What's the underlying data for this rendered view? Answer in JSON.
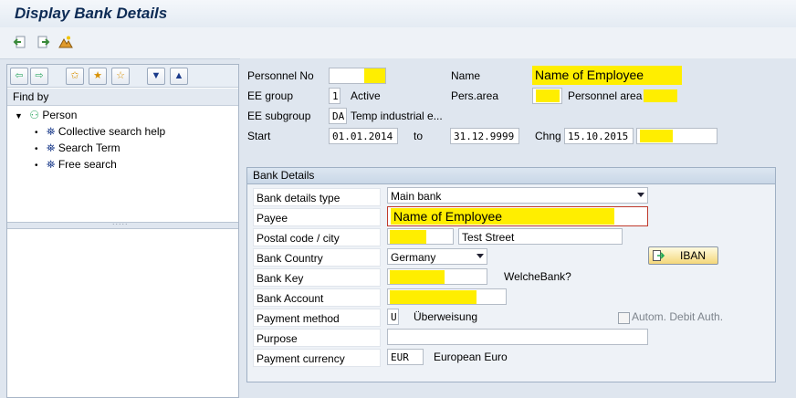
{
  "window": {
    "title": "Display Bank Details"
  },
  "toolbar": {
    "icons": [
      "previous-record-icon",
      "next-record-icon",
      "overview-icon"
    ]
  },
  "nav": {
    "buttons": [
      "back-icon",
      "forward-icon",
      "add-favorite-icon",
      "favorite-icon",
      "edit-favorite-icon",
      "expand-icon",
      "collapse-icon"
    ],
    "find_by_label": "Find by",
    "tree": {
      "root": "Person",
      "items": [
        "Collective search help",
        "Search Term",
        "Free search"
      ]
    }
  },
  "header": {
    "personnel_no_label": "Personnel No",
    "personnel_no_value": "",
    "name_label": "Name",
    "name_value": "Name of Employee",
    "ee_group_label": "EE group",
    "ee_group_code": "1",
    "ee_group_text": "Active",
    "pers_area_label": "Pers.area",
    "pers_area_code": "",
    "pers_area_text": "Personnel area",
    "ee_subgroup_label": "EE subgroup",
    "ee_subgroup_code": "DA",
    "ee_subgroup_text": "Temp industrial e...",
    "start_label": "Start",
    "start_value": "01.01.2014",
    "to_label": "to",
    "to_value": "31.12.9999",
    "chng_label": "Chng",
    "chng_value": "15.10.2015",
    "chng_user": ""
  },
  "bank": {
    "group_title": "Bank Details",
    "bank_details_type_label": "Bank details type",
    "bank_details_type_value": "Main bank",
    "payee_label": "Payee",
    "payee_value": "Name of Employee",
    "postal_label": "Postal code / city",
    "postal_value": "",
    "city_value": "Test Street",
    "country_label": "Bank Country",
    "country_value": "Germany",
    "iban_label": "IBAN",
    "bank_key_label": "Bank Key",
    "bank_key_value": "",
    "bank_name": "WelcheBank?",
    "account_label": "Bank Account",
    "account_value": "",
    "payment_method_label": "Payment method",
    "payment_method_code": "U",
    "payment_method_text": "Überweisung",
    "debit_auth_label": "Autom. Debit Auth.",
    "debit_auth_checked": false,
    "purpose_label": "Purpose",
    "purpose_value": "",
    "currency_label": "Payment currency",
    "currency_code": "EUR",
    "currency_text": "European Euro"
  },
  "colors": {
    "highlight": "#ffee00",
    "title": "#0d2b55"
  }
}
